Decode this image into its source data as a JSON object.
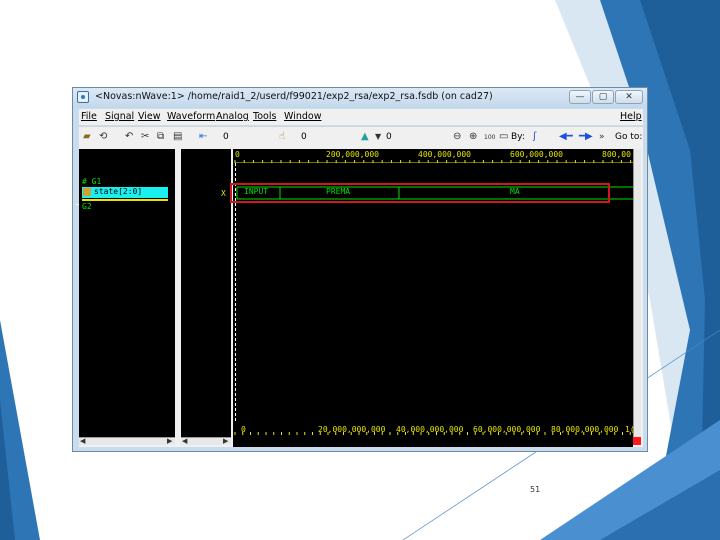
{
  "window": {
    "title": "<Novas:nWave:1> /home/raid1_2/userd/f99021/exp2_rsa/exp2_rsa.fsdb (on cad27)",
    "controls": {
      "minimize": "—",
      "maximize": "▢",
      "close": "✕"
    }
  },
  "menubar": {
    "items": [
      "File",
      "Signal",
      "View",
      "Waveform",
      "Analog",
      "Tools",
      "Window"
    ],
    "help": "Help"
  },
  "toolbar": {
    "cursor_value": "0",
    "marker_value": "0",
    "delta_value": "0",
    "by_label": "By:",
    "goto_label": "Go to:",
    "zoom_100": "100"
  },
  "signals": {
    "group1": "# G1",
    "group2": "G2",
    "selected_signal": "state[2:0]",
    "value_column": "X"
  },
  "waveform": {
    "top_ruler": [
      "0",
      "200,000,000",
      "400,000,000",
      "600,000,000",
      "800,00"
    ],
    "bottom_ruler": [
      "0",
      "20,000,000,000",
      "40,000,000,000",
      "60,000,000,000",
      "80,000,000,000",
      "1("
    ],
    "states": [
      "INPUT",
      "PREMA",
      "MA"
    ]
  },
  "colors": {
    "highlight_box": "#d01818",
    "selected_row": "#19f0f0",
    "signal_green": "#00e000",
    "ruler_yellow": "#e6e600"
  },
  "slide": {
    "page_number": "51"
  }
}
